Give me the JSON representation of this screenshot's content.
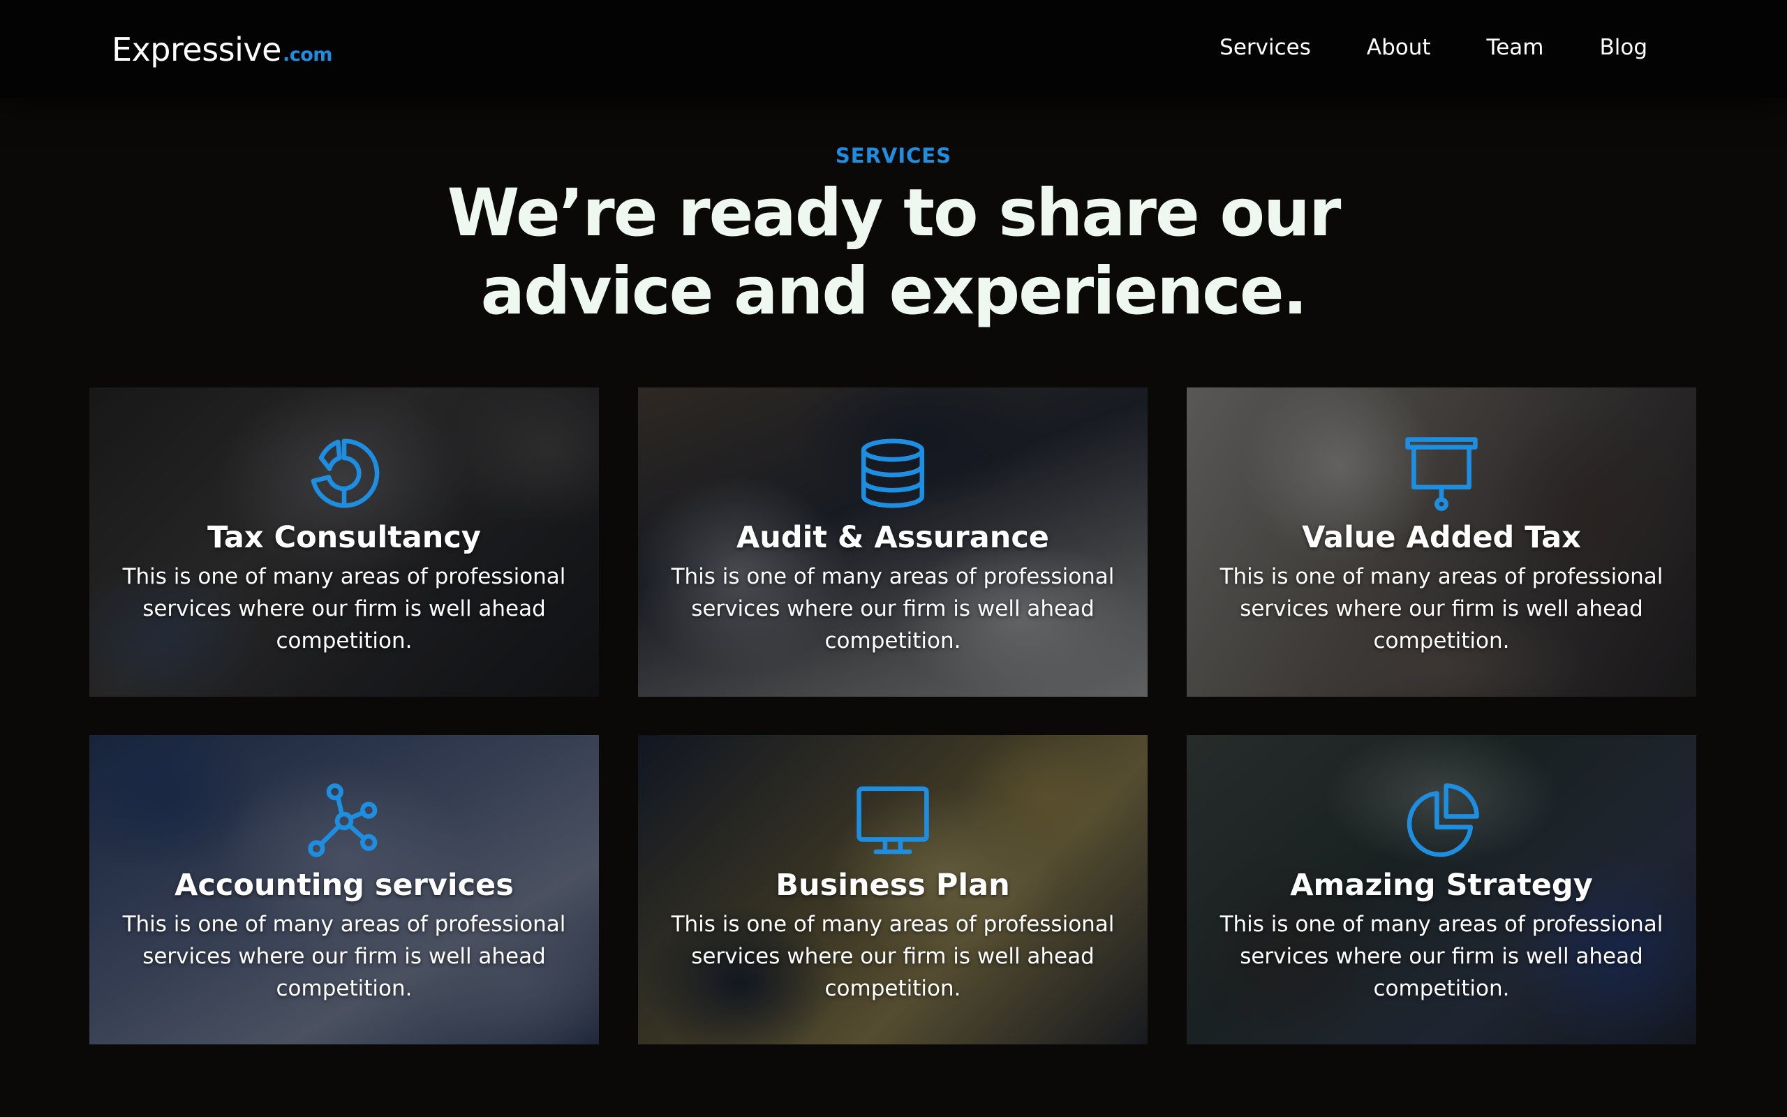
{
  "header": {
    "brand_name": "Expressive",
    "brand_tld": ".com",
    "nav": [
      {
        "label": "Services"
      },
      {
        "label": "About"
      },
      {
        "label": "Team"
      },
      {
        "label": "Blog"
      }
    ]
  },
  "hero": {
    "eyebrow": "SERVICES",
    "title_line1": "We’re ready to share our",
    "title_line2": "advice and experience."
  },
  "services": [
    {
      "title": "Tax Consultancy",
      "icon": "donut-chart-icon",
      "description": "This is one of many areas of professional services where our firm is well ahead competition."
    },
    {
      "title": "Audit & Assurance",
      "icon": "database-icon",
      "description": "This is one of many areas of professional services where our firm is well ahead competition."
    },
    {
      "title": "Value Added Tax",
      "icon": "presentation-board-icon",
      "description": "This is one of many areas of professional services where our firm is well ahead competition."
    },
    {
      "title": "Accounting services",
      "icon": "network-nodes-icon",
      "description": "This is one of many areas of professional services where our firm is well ahead competition."
    },
    {
      "title": "Business Plan",
      "icon": "monitor-icon",
      "description": "This is one of many areas of professional services where our firm is well ahead competition."
    },
    {
      "title": "Amazing Strategy",
      "icon": "pie-chart-icon",
      "description": "This is one of many areas of professional services where our firm is well ahead competition."
    }
  ],
  "colors": {
    "accent": "#1e8fe0",
    "background": "#0a0908",
    "header_bg": "#030303",
    "headline": "#eef7f0"
  }
}
